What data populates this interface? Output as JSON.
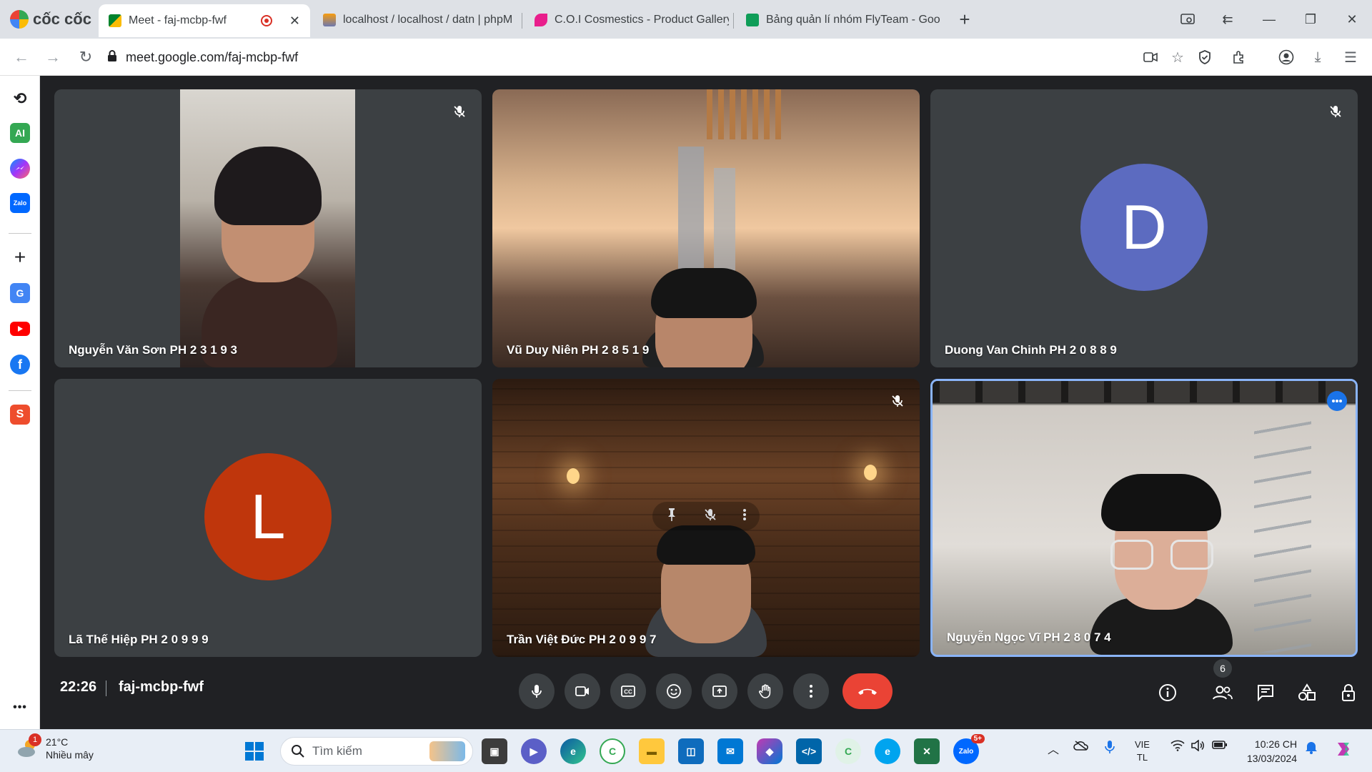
{
  "browser": {
    "brand": "cốc cốc",
    "tabs": [
      {
        "title": "Meet - faj-mcbp-fwf",
        "active": true
      },
      {
        "title": "localhost / localhost / datn | phpM",
        "active": false
      },
      {
        "title": "C.O.I Cosmestics - Product Gallery",
        "active": false
      },
      {
        "title": "Bảng quản lí nhóm FlyTeam - Goo",
        "active": false
      }
    ],
    "new_tab": "+",
    "url": "meet.google.com/faj-mcbp-fwf"
  },
  "sidebar": {
    "items": [
      "history-icon",
      "ai-icon",
      "messenger-icon",
      "zalo-icon",
      "add-icon",
      "translate-icon",
      "youtube-icon",
      "facebook-icon",
      "shopee-icon",
      "more-icon"
    ],
    "ai_label": "AI",
    "zalo_label": "Zalo",
    "more_label": "•••"
  },
  "meet": {
    "participants": [
      {
        "name": "Nguyễn Văn Sơn PH 2 3 1 9 3",
        "muted": true,
        "video": true
      },
      {
        "name": "Vũ Duy Niên PH 2 8 5 1 9",
        "muted": false,
        "video": true
      },
      {
        "name": "Duong Van Chinh PH 2 0 8 8 9",
        "muted": true,
        "video": false,
        "initial": "D",
        "avatar_color": "#5c6bc0"
      },
      {
        "name": "Lã Thế Hiệp PH 2 0 9 9 9",
        "muted": false,
        "video": false,
        "initial": "L",
        "avatar_color": "#bf360c"
      },
      {
        "name": "Trần Việt Đức PH 2 0 9 9 7",
        "muted": true,
        "video": true
      },
      {
        "name": "Nguyễn Ngọc Vĩ PH 2 8 0 7 4",
        "muted": false,
        "video": true,
        "active_speaker": true
      }
    ],
    "time": "22:26",
    "code": "faj-mcbp-fwf",
    "participant_count": "6",
    "accent": "#8ab4f8",
    "end_color": "#ea4335"
  },
  "taskbar": {
    "weather_temp": "21°C",
    "weather_desc": "Nhiều mây",
    "weather_badge": "1",
    "search_placeholder": "Tìm kiếm",
    "zalo_badge": "5+",
    "lang_top": "VIE",
    "lang_bottom": "TL",
    "time": "10:26 CH",
    "date": "13/03/2024"
  }
}
